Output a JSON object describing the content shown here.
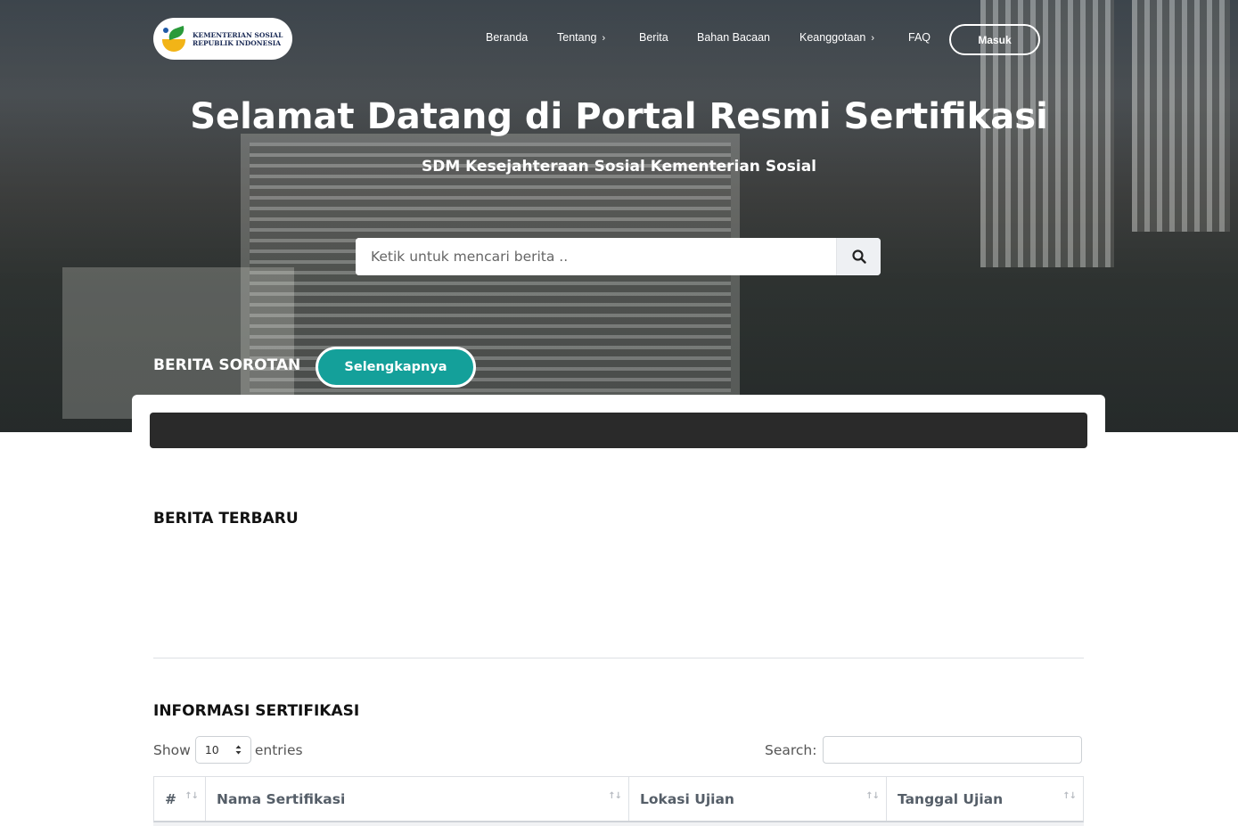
{
  "brand": {
    "logo_line1": "KEMENTERIAN SOSIAL",
    "logo_line2": "REPUBLIK INDONESIA"
  },
  "nav": {
    "items": [
      {
        "label": "Beranda",
        "has_dropdown": false
      },
      {
        "label": "Tentang",
        "has_dropdown": true
      },
      {
        "label": "Berita",
        "has_dropdown": false
      },
      {
        "label": "Bahan Bacaan",
        "has_dropdown": false
      },
      {
        "label": "Keanggotaan",
        "has_dropdown": true
      },
      {
        "label": "FAQ",
        "has_dropdown": false
      }
    ],
    "login_label": "Masuk"
  },
  "hero": {
    "title": "Selamat Datang di Portal Resmi Sertifikasi",
    "subtitle": "SDM Kesejahteraan Sosial Kementerian Sosial",
    "search_placeholder": "Ketik untuk mencari berita .."
  },
  "sorotan": {
    "label": "BERITA SOROTAN",
    "more_label": "Selengkapnya"
  },
  "terbaru": {
    "label": "BERITA TERBARU"
  },
  "sertifikasi": {
    "label": "INFORMASI SERTIFIKASI",
    "show_label": "Show",
    "entries_label": "entries",
    "page_length": "10",
    "search_label": "Search:",
    "columns": [
      "#",
      "Nama Sertifikasi",
      "Lokasi Ujian",
      "Tanggal Ujian"
    ]
  },
  "colors": {
    "accent": "#14a09a",
    "dark_bar": "#2a2a2a"
  }
}
